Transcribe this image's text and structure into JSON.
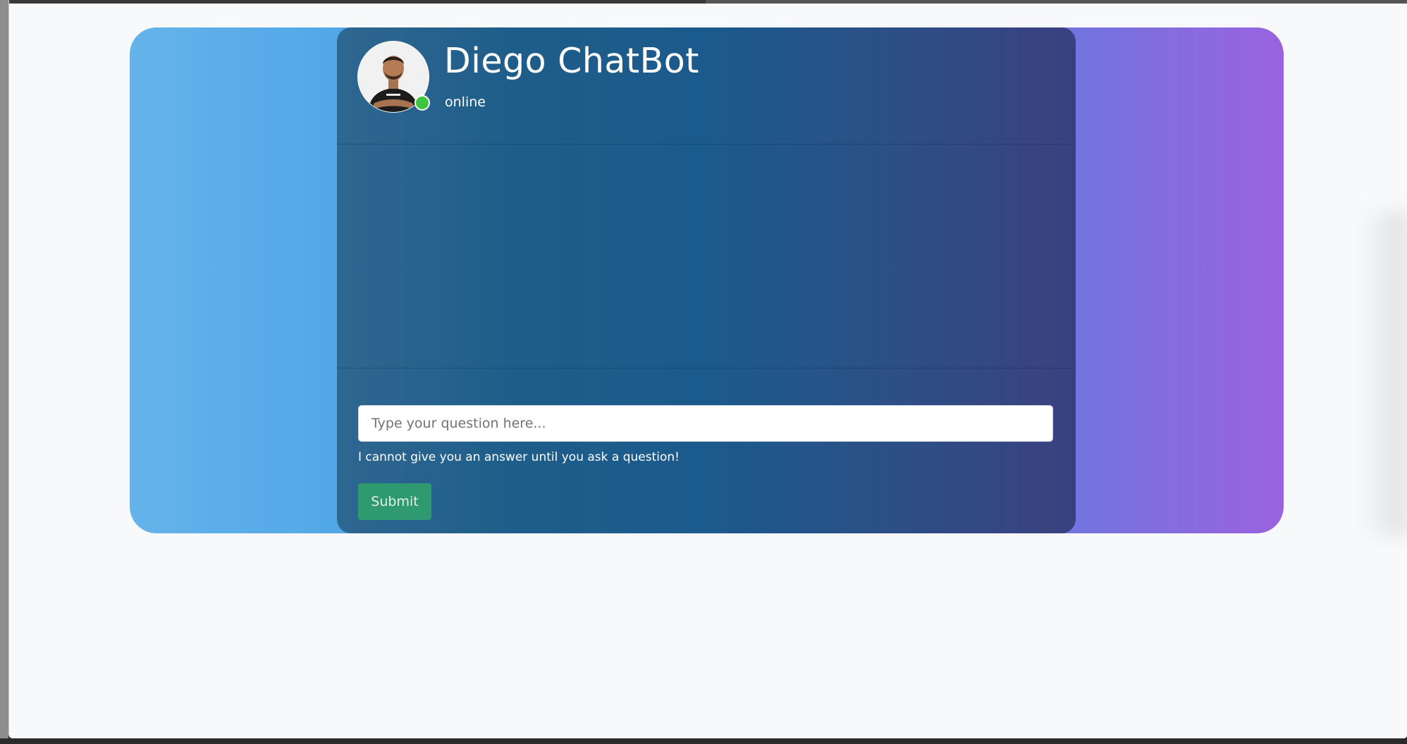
{
  "chatbot": {
    "title": "Diego ChatBot",
    "status": "online",
    "avatar": "profile-photo"
  },
  "form": {
    "placeholder": "Type your question here...",
    "hint": "I cannot give you an answer until you ask a question!",
    "submit_label": "Submit"
  },
  "colors": {
    "backdrop_gradient": [
      "#65b3ea",
      "#9a62df"
    ],
    "card_gradient": [
      "#2e6790",
      "#3a417f"
    ],
    "online_indicator": "#3ec43e",
    "submit_button": "#2f9a70"
  }
}
